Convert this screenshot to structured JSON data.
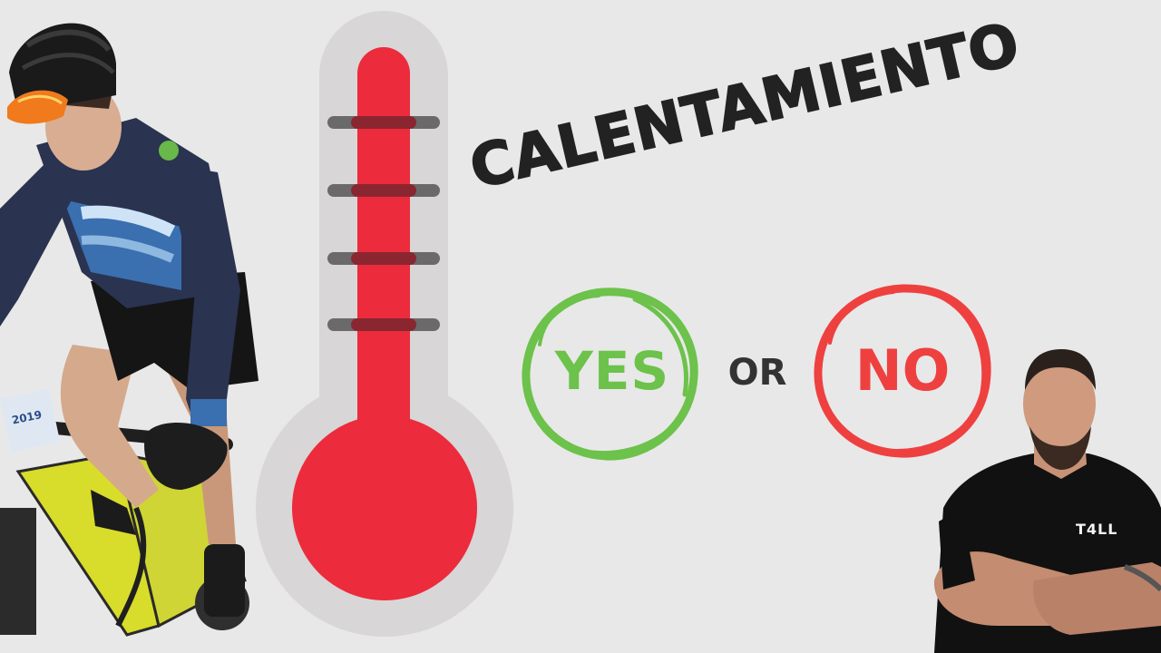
{
  "title": "CALENTAMIENTO",
  "options": {
    "yes": "YES",
    "or": "OR",
    "no": "NO"
  },
  "shirt_logo": "T4LL",
  "icons": {
    "thermometer": "thermometer-icon",
    "yes_ring": "green-circle-icon",
    "no_ring": "red-circle-icon"
  },
  "colors": {
    "background": "#e8e8e8",
    "thermometer_red": "#ec2b3c",
    "thermometer_outline": "#d8d6d6",
    "yes_green": "#6cc24a",
    "no_red": "#ef4040",
    "title": "#222222"
  }
}
